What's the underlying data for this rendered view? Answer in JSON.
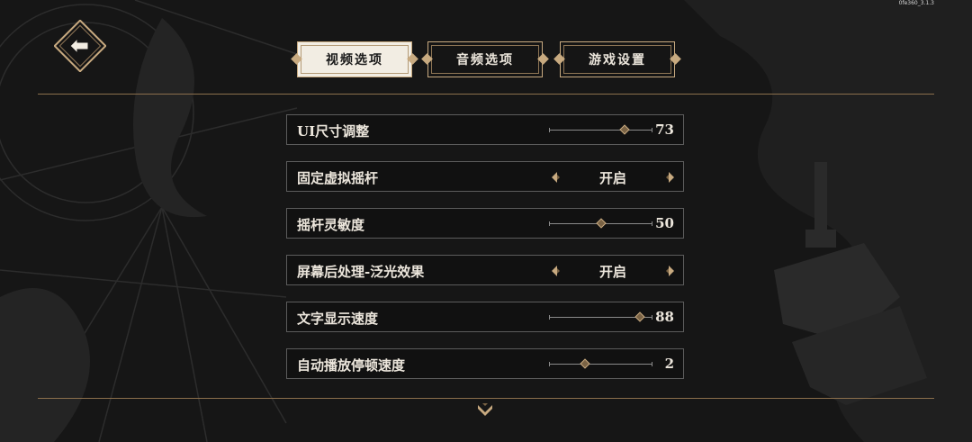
{
  "version": "0fe360_3.1.3",
  "tabs": [
    {
      "label": "视频选项",
      "active": true
    },
    {
      "label": "音频选项",
      "active": false
    },
    {
      "label": "游戏设置",
      "active": false
    }
  ],
  "settings": [
    {
      "label": "UI尺寸调整",
      "kind": "slider",
      "value": "73",
      "level": 0.73
    },
    {
      "label": "固定虚拟摇杆",
      "kind": "toggle",
      "value": "开启"
    },
    {
      "label": "摇杆灵敏度",
      "kind": "slider",
      "value": "50",
      "level": 0.5
    },
    {
      "label": "屏幕后处理-泛光效果",
      "kind": "toggle",
      "value": "开启"
    },
    {
      "label": "文字显示速度",
      "kind": "slider",
      "value": "88",
      "level": 0.88
    },
    {
      "label": "自动播放停顿速度",
      "kind": "slider",
      "value": "2",
      "level": 0.35
    }
  ],
  "colors": {
    "accent": "#c8aa80",
    "panel": "#111111",
    "border": "#5c5c5c",
    "text": "#ece6dc"
  },
  "icons": {
    "back": "back-arrow-icon",
    "left": "chevron-left-icon",
    "right": "chevron-right-icon",
    "more": "chevron-down-icon"
  }
}
